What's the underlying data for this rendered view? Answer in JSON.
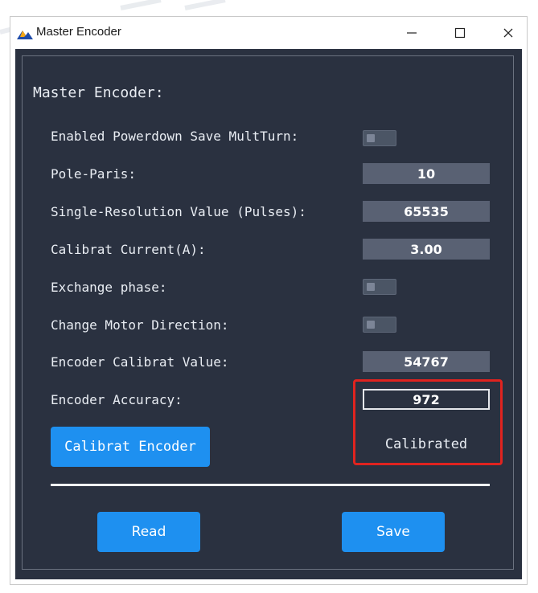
{
  "window": {
    "title": "Master Encoder"
  },
  "panel": {
    "section_title": "Master Encoder:",
    "rows": [
      {
        "label": "Enabled Powerdown Save MultTurn:",
        "type": "toggle",
        "on": false
      },
      {
        "label": "Pole-Paris:",
        "type": "value",
        "value": "10"
      },
      {
        "label": "Single-Resolution Value (Pulses):",
        "type": "value",
        "value": "65535"
      },
      {
        "label": "Calibrat Current(A):",
        "type": "value",
        "value": "3.00"
      },
      {
        "label": "Exchange phase:",
        "type": "toggle",
        "on": false
      },
      {
        "label": "Change Motor Direction:",
        "type": "toggle",
        "on": false
      },
      {
        "label": "Encoder Calibrat Value:",
        "type": "value",
        "value": "54767"
      },
      {
        "label": "Encoder Accuracy:",
        "type": "value",
        "value": "972"
      }
    ],
    "calibrate_button": "Calibrat Encoder",
    "calibration_status": "Calibrated",
    "read_button": "Read",
    "save_button": "Save"
  },
  "colors": {
    "background": "#2a3140",
    "value_box": "#596173",
    "button": "#1e90f0",
    "highlight": "#e0231f"
  },
  "icons": [
    "app-logo-icon",
    "minimize-icon",
    "maximize-icon",
    "close-icon"
  ]
}
